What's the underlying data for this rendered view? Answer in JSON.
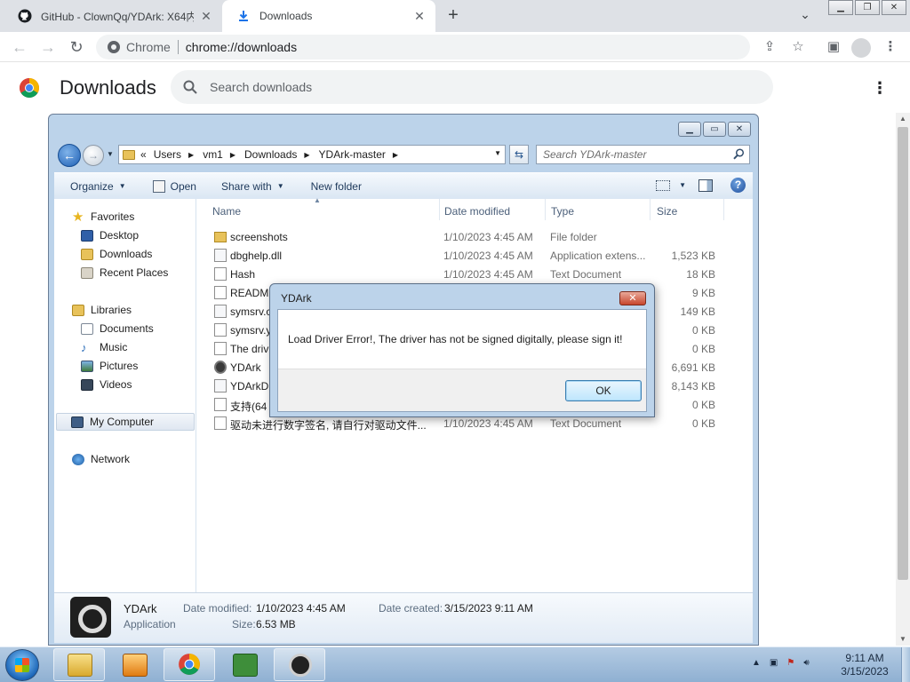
{
  "browser": {
    "tabs": [
      {
        "title": "GitHub - ClownQq/YDArk: X64内",
        "icon": "github-icon",
        "active": false
      },
      {
        "title": "Downloads",
        "icon": "download-icon",
        "active": true
      }
    ],
    "omnibox": {
      "site_label": "Chrome",
      "url": "chrome://downloads"
    }
  },
  "downloads_page": {
    "title": "Downloads",
    "search_placeholder": "Search downloads"
  },
  "explorer": {
    "address_segments": [
      "Users",
      "vm1",
      "Downloads",
      "YDArk-master"
    ],
    "address_prefix": "«",
    "search_placeholder": "Search YDArk-master",
    "commands": {
      "organize": "Organize",
      "open": "Open",
      "share_with": "Share with",
      "new_folder": "New folder"
    },
    "nav": {
      "favorites": "Favorites",
      "desktop": "Desktop",
      "downloads": "Downloads",
      "recent_places": "Recent Places",
      "libraries": "Libraries",
      "documents": "Documents",
      "music": "Music",
      "pictures": "Pictures",
      "videos": "Videos",
      "my_computer": "My Computer",
      "network": "Network"
    },
    "columns": {
      "name": "Name",
      "date_modified": "Date modified",
      "type": "Type",
      "size": "Size"
    },
    "files": [
      {
        "name": "screenshots",
        "date": "1/10/2023 4:45 AM",
        "type": "File folder",
        "size": "",
        "icon": "folder-icon"
      },
      {
        "name": "dbghelp.dll",
        "date": "1/10/2023 4:45 AM",
        "type": "Application extens...",
        "size": "1,523 KB",
        "icon": "dll-icon"
      },
      {
        "name": "Hash",
        "date": "1/10/2023 4:45 AM",
        "type": "Text Document",
        "size": "18 KB",
        "icon": "document-icon"
      },
      {
        "name": "READM",
        "date": "",
        "type": "",
        "size": "9 KB",
        "icon": "document-icon"
      },
      {
        "name": "symsrv.c",
        "date": "",
        "type": "",
        "size": "149 KB",
        "icon": "dll-icon"
      },
      {
        "name": "symsrv.y",
        "date": "",
        "type": "",
        "size": "0 KB",
        "icon": "document-icon"
      },
      {
        "name": "The driv",
        "date": "",
        "type": "",
        "size": "0 KB",
        "icon": "document-icon"
      },
      {
        "name": "YDArk",
        "date": "",
        "type": "",
        "size": "6,691 KB",
        "icon": "app-gear-icon"
      },
      {
        "name": "YDArkDr",
        "date": "",
        "type": "",
        "size": "8,143 KB",
        "icon": "dll-icon"
      },
      {
        "name": "支持(64",
        "date": "",
        "type": "",
        "size": "0 KB",
        "icon": "document-icon"
      },
      {
        "name": "驱动未进行数字签名, 请自行对驱动文件...",
        "date": "1/10/2023 4:45 AM",
        "type": "Text Document",
        "size": "0 KB",
        "icon": "document-icon"
      }
    ],
    "details": {
      "name": "YDArk",
      "type": "Application",
      "modified_label": "Date modified:",
      "modified_value": "1/10/2023 4:45 AM",
      "created_label": "Date created:",
      "created_value": "3/15/2023 9:11 AM",
      "size_label": "Size:",
      "size_value": "6.53 MB"
    }
  },
  "dialog": {
    "title": "YDArk",
    "message": "Load Driver Error!, The driver has not be signed digitally, please sign it!",
    "ok_label": "OK"
  },
  "taskbar": {
    "time": "9:11 AM",
    "date": "3/15/2023"
  }
}
